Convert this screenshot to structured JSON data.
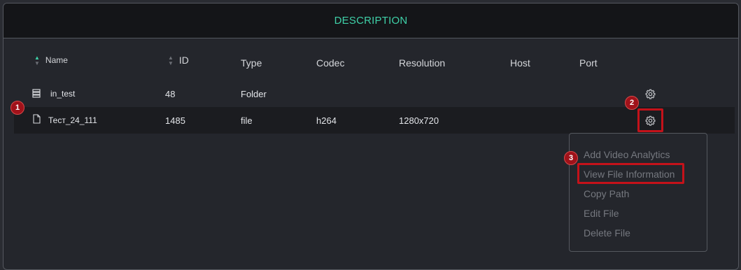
{
  "header": {
    "title": "DESCRIPTION"
  },
  "columns": {
    "name": "Name",
    "id": "ID",
    "type": "Type",
    "codec": "Codec",
    "resolution": "Resolution",
    "host": "Host",
    "port": "Port"
  },
  "rows": [
    {
      "icon": "storage-icon",
      "name": "in_test",
      "id": "48",
      "type": "Folder",
      "codec": "",
      "resolution": "",
      "host": "",
      "port": ""
    },
    {
      "icon": "file-icon",
      "name": "Тест_24_111",
      "id": "1485",
      "type": "file",
      "codec": "h264",
      "resolution": "1280x720",
      "host": "",
      "port": ""
    }
  ],
  "menu": {
    "items": [
      "Add Video Analytics",
      "View File Information",
      "Copy Path",
      "Edit File",
      "Delete File"
    ]
  },
  "badges": [
    "1",
    "2",
    "3"
  ],
  "colors": {
    "accent": "#3fd1a8",
    "highlight": "#c4121a",
    "badge": "#a0121a"
  }
}
